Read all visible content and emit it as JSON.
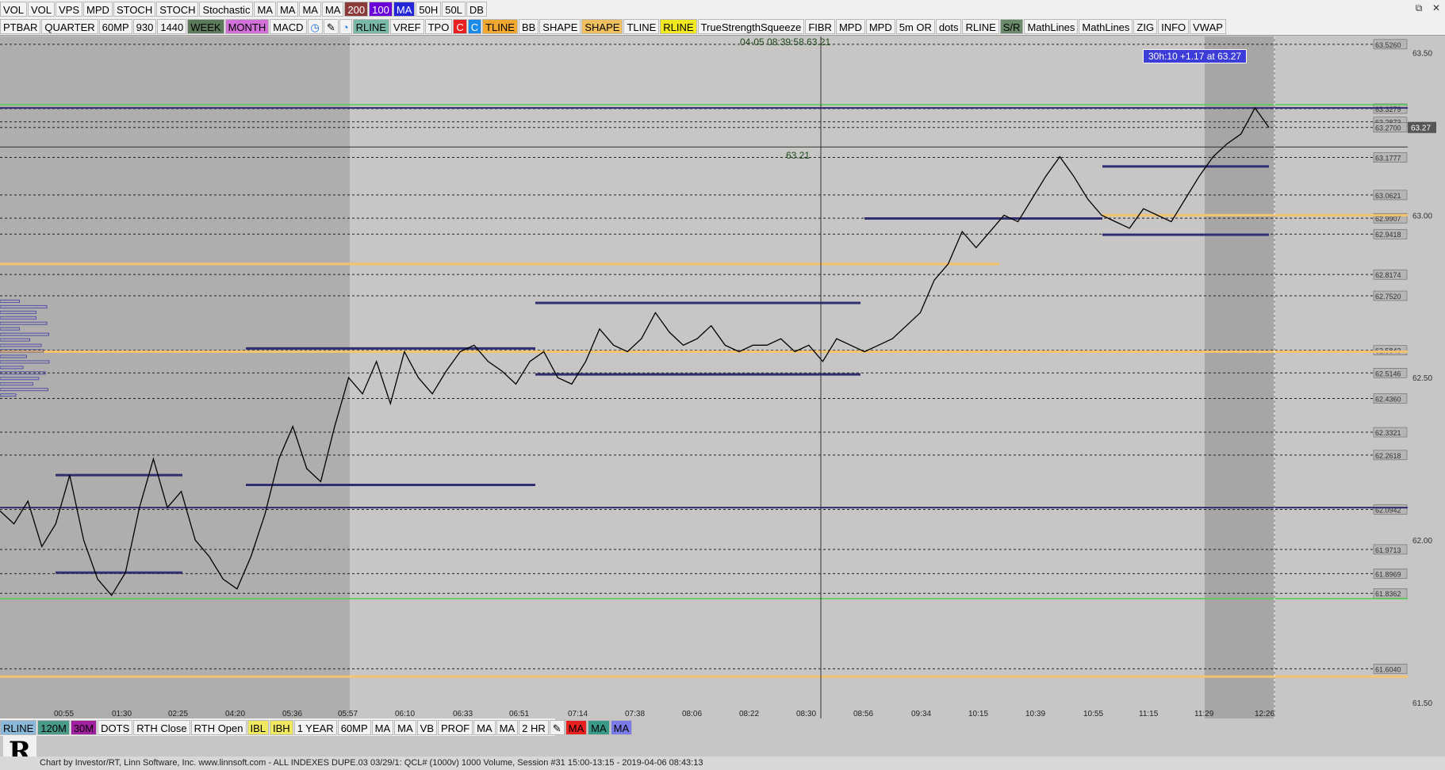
{
  "toolbar_top1": [
    {
      "label": "VOL",
      "bg": "#f3f3f3",
      "fg": "#000"
    },
    {
      "label": "VOL",
      "bg": "#f3f3f3",
      "fg": "#000"
    },
    {
      "label": "VPS",
      "bg": "#f3f3f3",
      "fg": "#000"
    },
    {
      "label": "MPD",
      "bg": "#f3f3f3",
      "fg": "#000"
    },
    {
      "label": "STOCH",
      "bg": "#f3f3f3",
      "fg": "#000"
    },
    {
      "label": "STOCH",
      "bg": "#f3f3f3",
      "fg": "#000"
    },
    {
      "label": "Stochastic",
      "bg": "#f3f3f3",
      "fg": "#000"
    },
    {
      "label": "MA",
      "bg": "#f3f3f3",
      "fg": "#000"
    },
    {
      "label": "MA",
      "bg": "#f3f3f3",
      "fg": "#000"
    },
    {
      "label": "MA",
      "bg": "#f3f3f3",
      "fg": "#000"
    },
    {
      "label": "MA",
      "bg": "#f3f3f3",
      "fg": "#000"
    },
    {
      "label": "200",
      "bg": "#8b3a3a",
      "fg": "#fff"
    },
    {
      "label": "100",
      "bg": "#6a00d8",
      "fg": "#fff"
    },
    {
      "label": "MA",
      "bg": "#2424d8",
      "fg": "#fff"
    },
    {
      "label": "50H",
      "bg": "#f3f3f3",
      "fg": "#000"
    },
    {
      "label": "50L",
      "bg": "#f3f3f3",
      "fg": "#000"
    },
    {
      "label": "DB",
      "bg": "#f3f3f3",
      "fg": "#000"
    }
  ],
  "toolbar_top2": [
    {
      "label": "PTBAR",
      "bg": "#f3f3f3",
      "fg": "#000"
    },
    {
      "label": "QUARTER",
      "bg": "#f3f3f3",
      "fg": "#000"
    },
    {
      "label": "60MP",
      "bg": "#f3f3f3",
      "fg": "#000"
    },
    {
      "label": "930",
      "bg": "#f3f3f3",
      "fg": "#000"
    },
    {
      "label": "1440",
      "bg": "#f3f3f3",
      "fg": "#000"
    },
    {
      "label": "WEEK",
      "bg": "#5a7a5a",
      "fg": "#000"
    },
    {
      "label": "MONTH",
      "bg": "#d070d8",
      "fg": "#000"
    },
    {
      "label": "MACD",
      "bg": "#f3f3f3",
      "fg": "#000"
    },
    {
      "label": "◷",
      "bg": "#f3f3f3",
      "fg": "#1a6fd8",
      "icon": "clock-icon"
    },
    {
      "label": "✎",
      "bg": "#f3f3f3",
      "fg": "#000",
      "icon": "pencil-icon"
    },
    {
      "label": "◔",
      "bg": "#f3f3f3",
      "fg": "#1a6fd8",
      "icon": "timer-icon"
    },
    {
      "label": "RLINE",
      "bg": "#7ab8a8",
      "fg": "#000"
    },
    {
      "label": "VREF",
      "bg": "#f3f3f3",
      "fg": "#000"
    },
    {
      "label": "TPO",
      "bg": "#f3f3f3",
      "fg": "#000"
    },
    {
      "label": "C",
      "bg": "#e82020",
      "fg": "#fff"
    },
    {
      "label": "C",
      "bg": "#1a8ae8",
      "fg": "#fff"
    },
    {
      "label": "TLINE",
      "bg": "#f0a830",
      "fg": "#000"
    },
    {
      "label": "BB",
      "bg": "#f3f3f3",
      "fg": "#000"
    },
    {
      "label": "SHAPE",
      "bg": "#f3f3f3",
      "fg": "#000"
    },
    {
      "label": "SHAPE",
      "bg": "#f0c060",
      "fg": "#000"
    },
    {
      "label": "TLINE",
      "bg": "#f3f3f3",
      "fg": "#000"
    },
    {
      "label": "RLINE",
      "bg": "#f0e820",
      "fg": "#000"
    },
    {
      "label": "TrueStrengthSqueeze",
      "bg": "#f3f3f3",
      "fg": "#000"
    },
    {
      "label": "FIBR",
      "bg": "#f3f3f3",
      "fg": "#000"
    },
    {
      "label": "MPD",
      "bg": "#f3f3f3",
      "fg": "#000"
    },
    {
      "label": "MPD",
      "bg": "#f3f3f3",
      "fg": "#000"
    },
    {
      "label": "5m OR",
      "bg": "#f3f3f3",
      "fg": "#000"
    },
    {
      "label": "dots",
      "bg": "#f3f3f3",
      "fg": "#000"
    },
    {
      "label": "RLINE",
      "bg": "#f3f3f3",
      "fg": "#000"
    },
    {
      "label": "S/R",
      "bg": "#6a8a6a",
      "fg": "#000"
    },
    {
      "label": "MathLines",
      "bg": "#f3f3f3",
      "fg": "#000"
    },
    {
      "label": "MathLines",
      "bg": "#f3f3f3",
      "fg": "#000"
    },
    {
      "label": "ZIG",
      "bg": "#f3f3f3",
      "fg": "#000"
    },
    {
      "label": "INFO",
      "bg": "#f3f3f3",
      "fg": "#000"
    },
    {
      "label": "VWAP",
      "bg": "#f3f3f3",
      "fg": "#000"
    }
  ],
  "toolbar_bottom": [
    {
      "label": "RLINE",
      "bg": "#8ab8d8",
      "fg": "#000"
    },
    {
      "label": "120M",
      "bg": "#4a9a8a",
      "fg": "#000"
    },
    {
      "label": "30M",
      "bg": "#a020a0",
      "fg": "#000"
    },
    {
      "label": "DOTS",
      "bg": "#f3f3f3",
      "fg": "#000"
    },
    {
      "label": "RTH Close",
      "bg": "#f3f3f3",
      "fg": "#000"
    },
    {
      "label": "RTH Open",
      "bg": "#f3f3f3",
      "fg": "#000"
    },
    {
      "label": "IBL",
      "bg": "#f0e860",
      "fg": "#000"
    },
    {
      "label": "IBH",
      "bg": "#f0e860",
      "fg": "#000"
    },
    {
      "label": "1 YEAR",
      "bg": "#f3f3f3",
      "fg": "#000"
    },
    {
      "label": "60MP",
      "bg": "#f3f3f3",
      "fg": "#000"
    },
    {
      "label": "MA",
      "bg": "#f3f3f3",
      "fg": "#000"
    },
    {
      "label": "MA",
      "bg": "#f3f3f3",
      "fg": "#000"
    },
    {
      "label": "VB",
      "bg": "#f3f3f3",
      "fg": "#000"
    },
    {
      "label": "PROF",
      "bg": "#f3f3f3",
      "fg": "#000"
    },
    {
      "label": "MA",
      "bg": "#f3f3f3",
      "fg": "#000"
    },
    {
      "label": "MA",
      "bg": "#f3f3f3",
      "fg": "#000"
    },
    {
      "label": "2 HR",
      "bg": "#f3f3f3",
      "fg": "#000"
    },
    {
      "label": "✎",
      "bg": "#f3f3f3",
      "fg": "#000",
      "icon": "pencil-icon"
    },
    {
      "label": "MA",
      "bg": "#e82020",
      "fg": "#000"
    },
    {
      "label": "MA",
      "bg": "#3a9a8a",
      "fg": "#000"
    },
    {
      "label": "MA",
      "bg": "#7a7ae8",
      "fg": "#000"
    }
  ],
  "window_controls": {
    "restore": "⧉",
    "close": "✕"
  },
  "cursor": {
    "timestamp": "04-05 08:39:58",
    "price": "63.21",
    "price_line_label": "63.21"
  },
  "badge": {
    "text": "30h:10  +1.17 at 63.27"
  },
  "status": {
    "text": "Chart by Investor/RT, Linn Software, Inc. www.linnsoft.com - ALL INDEXES DUPE.03    03/29/1: QCL# (1000v) 1000 Volume, Session #31 15:00-13:15 - 2019-04-06 08:43:13"
  },
  "logo": {
    "text": "R"
  },
  "colors": {
    "bg_dark": "#b0aeac",
    "bg_light": "#c8c6c4",
    "navy": "#2e2e70",
    "orange": "#f4c46c",
    "green": "#50d050",
    "price_tag": "#3c3cd8"
  },
  "chart_data": {
    "type": "line",
    "symbol": "QCL#",
    "y_axis_ticks": [
      "63.50",
      "63.00",
      "62.50",
      "62.00",
      "61.50"
    ],
    "ylim": [
      61.5,
      63.55
    ],
    "x_ticks": [
      "00:55",
      "01:30",
      "02:25",
      "04:20",
      "05:36",
      "05:57",
      "06:10",
      "06:33",
      "06:51",
      "07:14",
      "07:38",
      "08:06",
      "08:22",
      "08:30",
      "08:56",
      "09:34",
      "10:15",
      "10:39",
      "10:55",
      "11:15",
      "11:29",
      "12:26"
    ],
    "last_price": "63.27",
    "level_labels": [
      "63.5260",
      "63.3279",
      "63.2873",
      "63.2700",
      "63.1777",
      "63.0621",
      "62.9907",
      "62.9418",
      "62.8174",
      "62.7520",
      "62.5843",
      "62.5146",
      "62.4360",
      "62.3321",
      "62.2618",
      "62.0942",
      "61.9713",
      "61.8969",
      "61.8362",
      "61.6040"
    ],
    "levels": [
      63.526,
      63.3279,
      63.2873,
      63.27,
      63.1777,
      63.0621,
      62.9907,
      62.9418,
      62.8174,
      62.752,
      62.5843,
      62.5146,
      62.436,
      62.3321,
      62.2618,
      62.0942,
      61.9713,
      61.8969,
      61.8362,
      61.604
    ],
    "price_path": [
      [
        0,
        62.09
      ],
      [
        0.01,
        62.05
      ],
      [
        0.02,
        62.12
      ],
      [
        0.03,
        61.98
      ],
      [
        0.04,
        62.05
      ],
      [
        0.05,
        62.2
      ],
      [
        0.06,
        62.0
      ],
      [
        0.07,
        61.88
      ],
      [
        0.08,
        61.83
      ],
      [
        0.09,
        61.9
      ],
      [
        0.1,
        62.1
      ],
      [
        0.11,
        62.25
      ],
      [
        0.12,
        62.1
      ],
      [
        0.13,
        62.15
      ],
      [
        0.14,
        62.0
      ],
      [
        0.15,
        61.95
      ],
      [
        0.16,
        61.88
      ],
      [
        0.17,
        61.85
      ],
      [
        0.18,
        61.95
      ],
      [
        0.19,
        62.08
      ],
      [
        0.2,
        62.25
      ],
      [
        0.21,
        62.35
      ],
      [
        0.22,
        62.22
      ],
      [
        0.23,
        62.18
      ],
      [
        0.24,
        62.35
      ],
      [
        0.25,
        62.5
      ],
      [
        0.26,
        62.45
      ],
      [
        0.27,
        62.55
      ],
      [
        0.28,
        62.42
      ],
      [
        0.29,
        62.58
      ],
      [
        0.3,
        62.5
      ],
      [
        0.31,
        62.45
      ],
      [
        0.32,
        62.52
      ],
      [
        0.33,
        62.58
      ],
      [
        0.34,
        62.6
      ],
      [
        0.35,
        62.55
      ],
      [
        0.36,
        62.52
      ],
      [
        0.37,
        62.48
      ],
      [
        0.38,
        62.55
      ],
      [
        0.39,
        62.58
      ],
      [
        0.4,
        62.5
      ],
      [
        0.41,
        62.48
      ],
      [
        0.42,
        62.55
      ],
      [
        0.43,
        62.65
      ],
      [
        0.44,
        62.6
      ],
      [
        0.45,
        62.58
      ],
      [
        0.46,
        62.62
      ],
      [
        0.47,
        62.7
      ],
      [
        0.48,
        62.64
      ],
      [
        0.49,
        62.6
      ],
      [
        0.5,
        62.62
      ],
      [
        0.51,
        62.66
      ],
      [
        0.52,
        62.6
      ],
      [
        0.53,
        62.58
      ],
      [
        0.54,
        62.6
      ],
      [
        0.55,
        62.6
      ],
      [
        0.56,
        62.62
      ],
      [
        0.57,
        62.58
      ],
      [
        0.58,
        62.6
      ],
      [
        0.59,
        62.55
      ],
      [
        0.6,
        62.62
      ],
      [
        0.61,
        62.6
      ],
      [
        0.62,
        62.58
      ],
      [
        0.63,
        62.6
      ],
      [
        0.64,
        62.62
      ],
      [
        0.65,
        62.66
      ],
      [
        0.66,
        62.7
      ],
      [
        0.67,
        62.8
      ],
      [
        0.68,
        62.85
      ],
      [
        0.69,
        62.95
      ],
      [
        0.7,
        62.9
      ],
      [
        0.71,
        62.95
      ],
      [
        0.72,
        63.0
      ],
      [
        0.73,
        62.98
      ],
      [
        0.74,
        63.05
      ],
      [
        0.75,
        63.12
      ],
      [
        0.76,
        63.18
      ],
      [
        0.77,
        63.12
      ],
      [
        0.78,
        63.05
      ],
      [
        0.79,
        63.0
      ],
      [
        0.8,
        62.98
      ],
      [
        0.81,
        62.96
      ],
      [
        0.82,
        63.02
      ],
      [
        0.83,
        63.0
      ],
      [
        0.84,
        62.98
      ],
      [
        0.85,
        63.05
      ],
      [
        0.86,
        63.12
      ],
      [
        0.87,
        63.18
      ],
      [
        0.88,
        63.22
      ],
      [
        0.89,
        63.25
      ],
      [
        0.9,
        63.33
      ],
      [
        0.905,
        63.3
      ],
      [
        0.91,
        63.27
      ]
    ]
  }
}
